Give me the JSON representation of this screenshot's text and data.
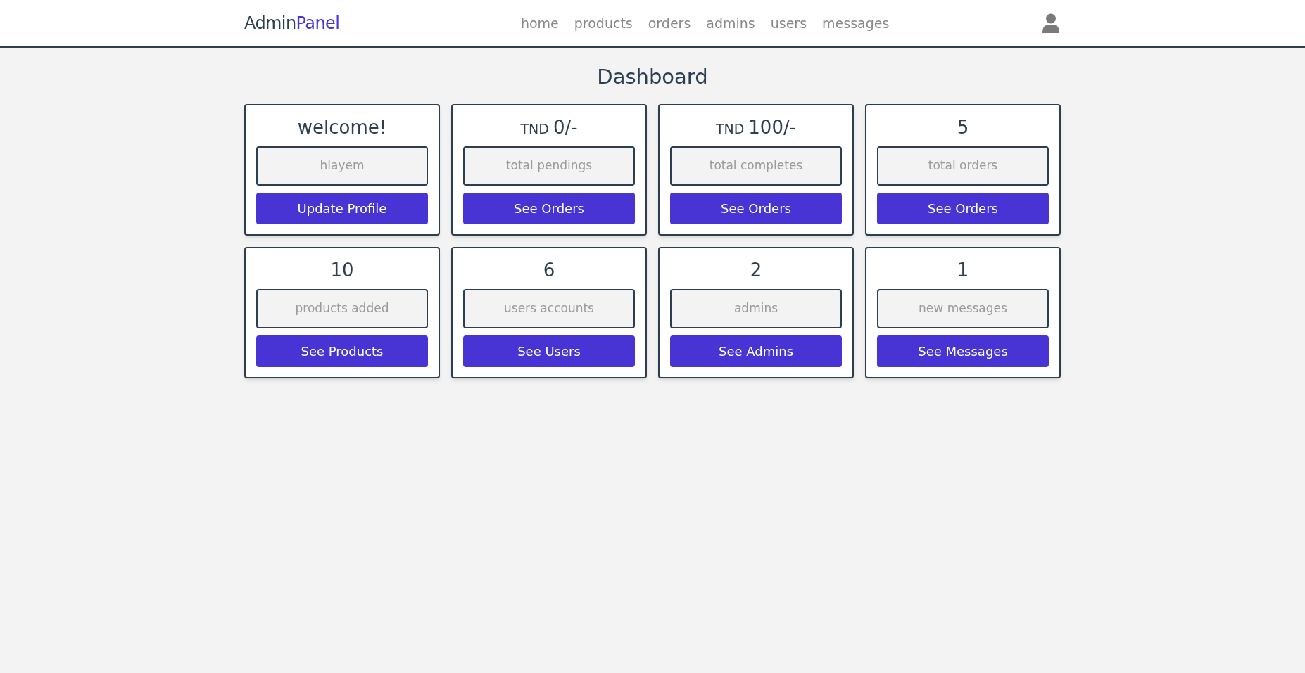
{
  "header": {
    "logo": {
      "first": "Admin",
      "second": "Panel"
    },
    "nav": [
      "home",
      "products",
      "orders",
      "admins",
      "users",
      "messages"
    ]
  },
  "title": "Dashboard",
  "cards": [
    {
      "value": "welcome!",
      "caption": "hlayem",
      "button": "Update Profile"
    },
    {
      "prefix": "TND",
      "value": "0/-",
      "caption": "total pendings",
      "button": "See Orders"
    },
    {
      "prefix": "TND",
      "value": "100/-",
      "caption": "total completes",
      "button": "See Orders"
    },
    {
      "value": "5",
      "caption": "total orders",
      "button": "See Orders"
    },
    {
      "value": "10",
      "caption": "products added",
      "button": "See Products"
    },
    {
      "value": "6",
      "caption": "users accounts",
      "button": "See Users"
    },
    {
      "value": "2",
      "caption": "admins",
      "button": "See Admins"
    },
    {
      "value": "1",
      "caption": "new messages",
      "button": "See Messages"
    }
  ]
}
